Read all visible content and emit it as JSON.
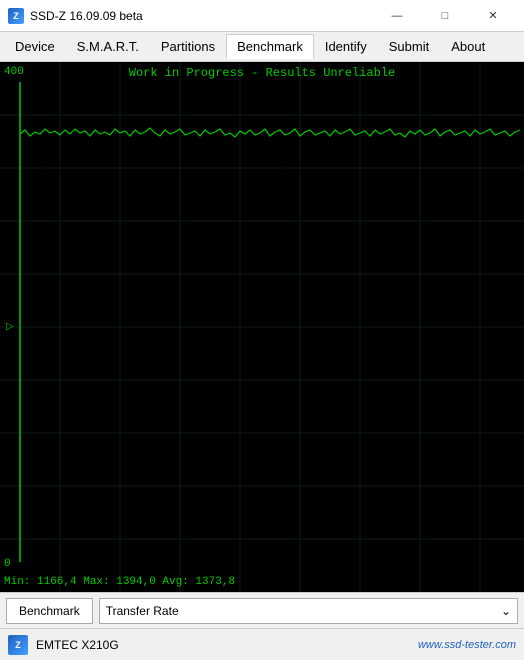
{
  "window": {
    "title": "SSD-Z 16.09.09 beta",
    "icon": "SSD"
  },
  "window_controls": {
    "minimize": "—",
    "maximize": "□",
    "close": "✕"
  },
  "menu": {
    "items": [
      {
        "label": "Device",
        "active": false
      },
      {
        "label": "S.M.A.R.T.",
        "active": false
      },
      {
        "label": "Partitions",
        "active": false
      },
      {
        "label": "Benchmark",
        "active": true
      },
      {
        "label": "Identify",
        "active": false
      },
      {
        "label": "Submit",
        "active": false
      },
      {
        "label": "About",
        "active": false
      }
    ]
  },
  "chart": {
    "title": "Work in Progress - Results Unreliable",
    "y_max": "400",
    "y_min": "0",
    "stats": "Min: 1166,4  Max: 1394,0  Avg: 1373,8",
    "bg_color": "#000000",
    "grid_color": "#1a3a1a",
    "line_color": "#00cc00",
    "arrow": "▷"
  },
  "controls": {
    "benchmark_button": "Benchmark",
    "dropdown_value": "Transfer Rate",
    "dropdown_arrow": "⌄"
  },
  "status_bar": {
    "device": "EMTEC X210G",
    "watermark": "www.ssd-tester.com"
  }
}
